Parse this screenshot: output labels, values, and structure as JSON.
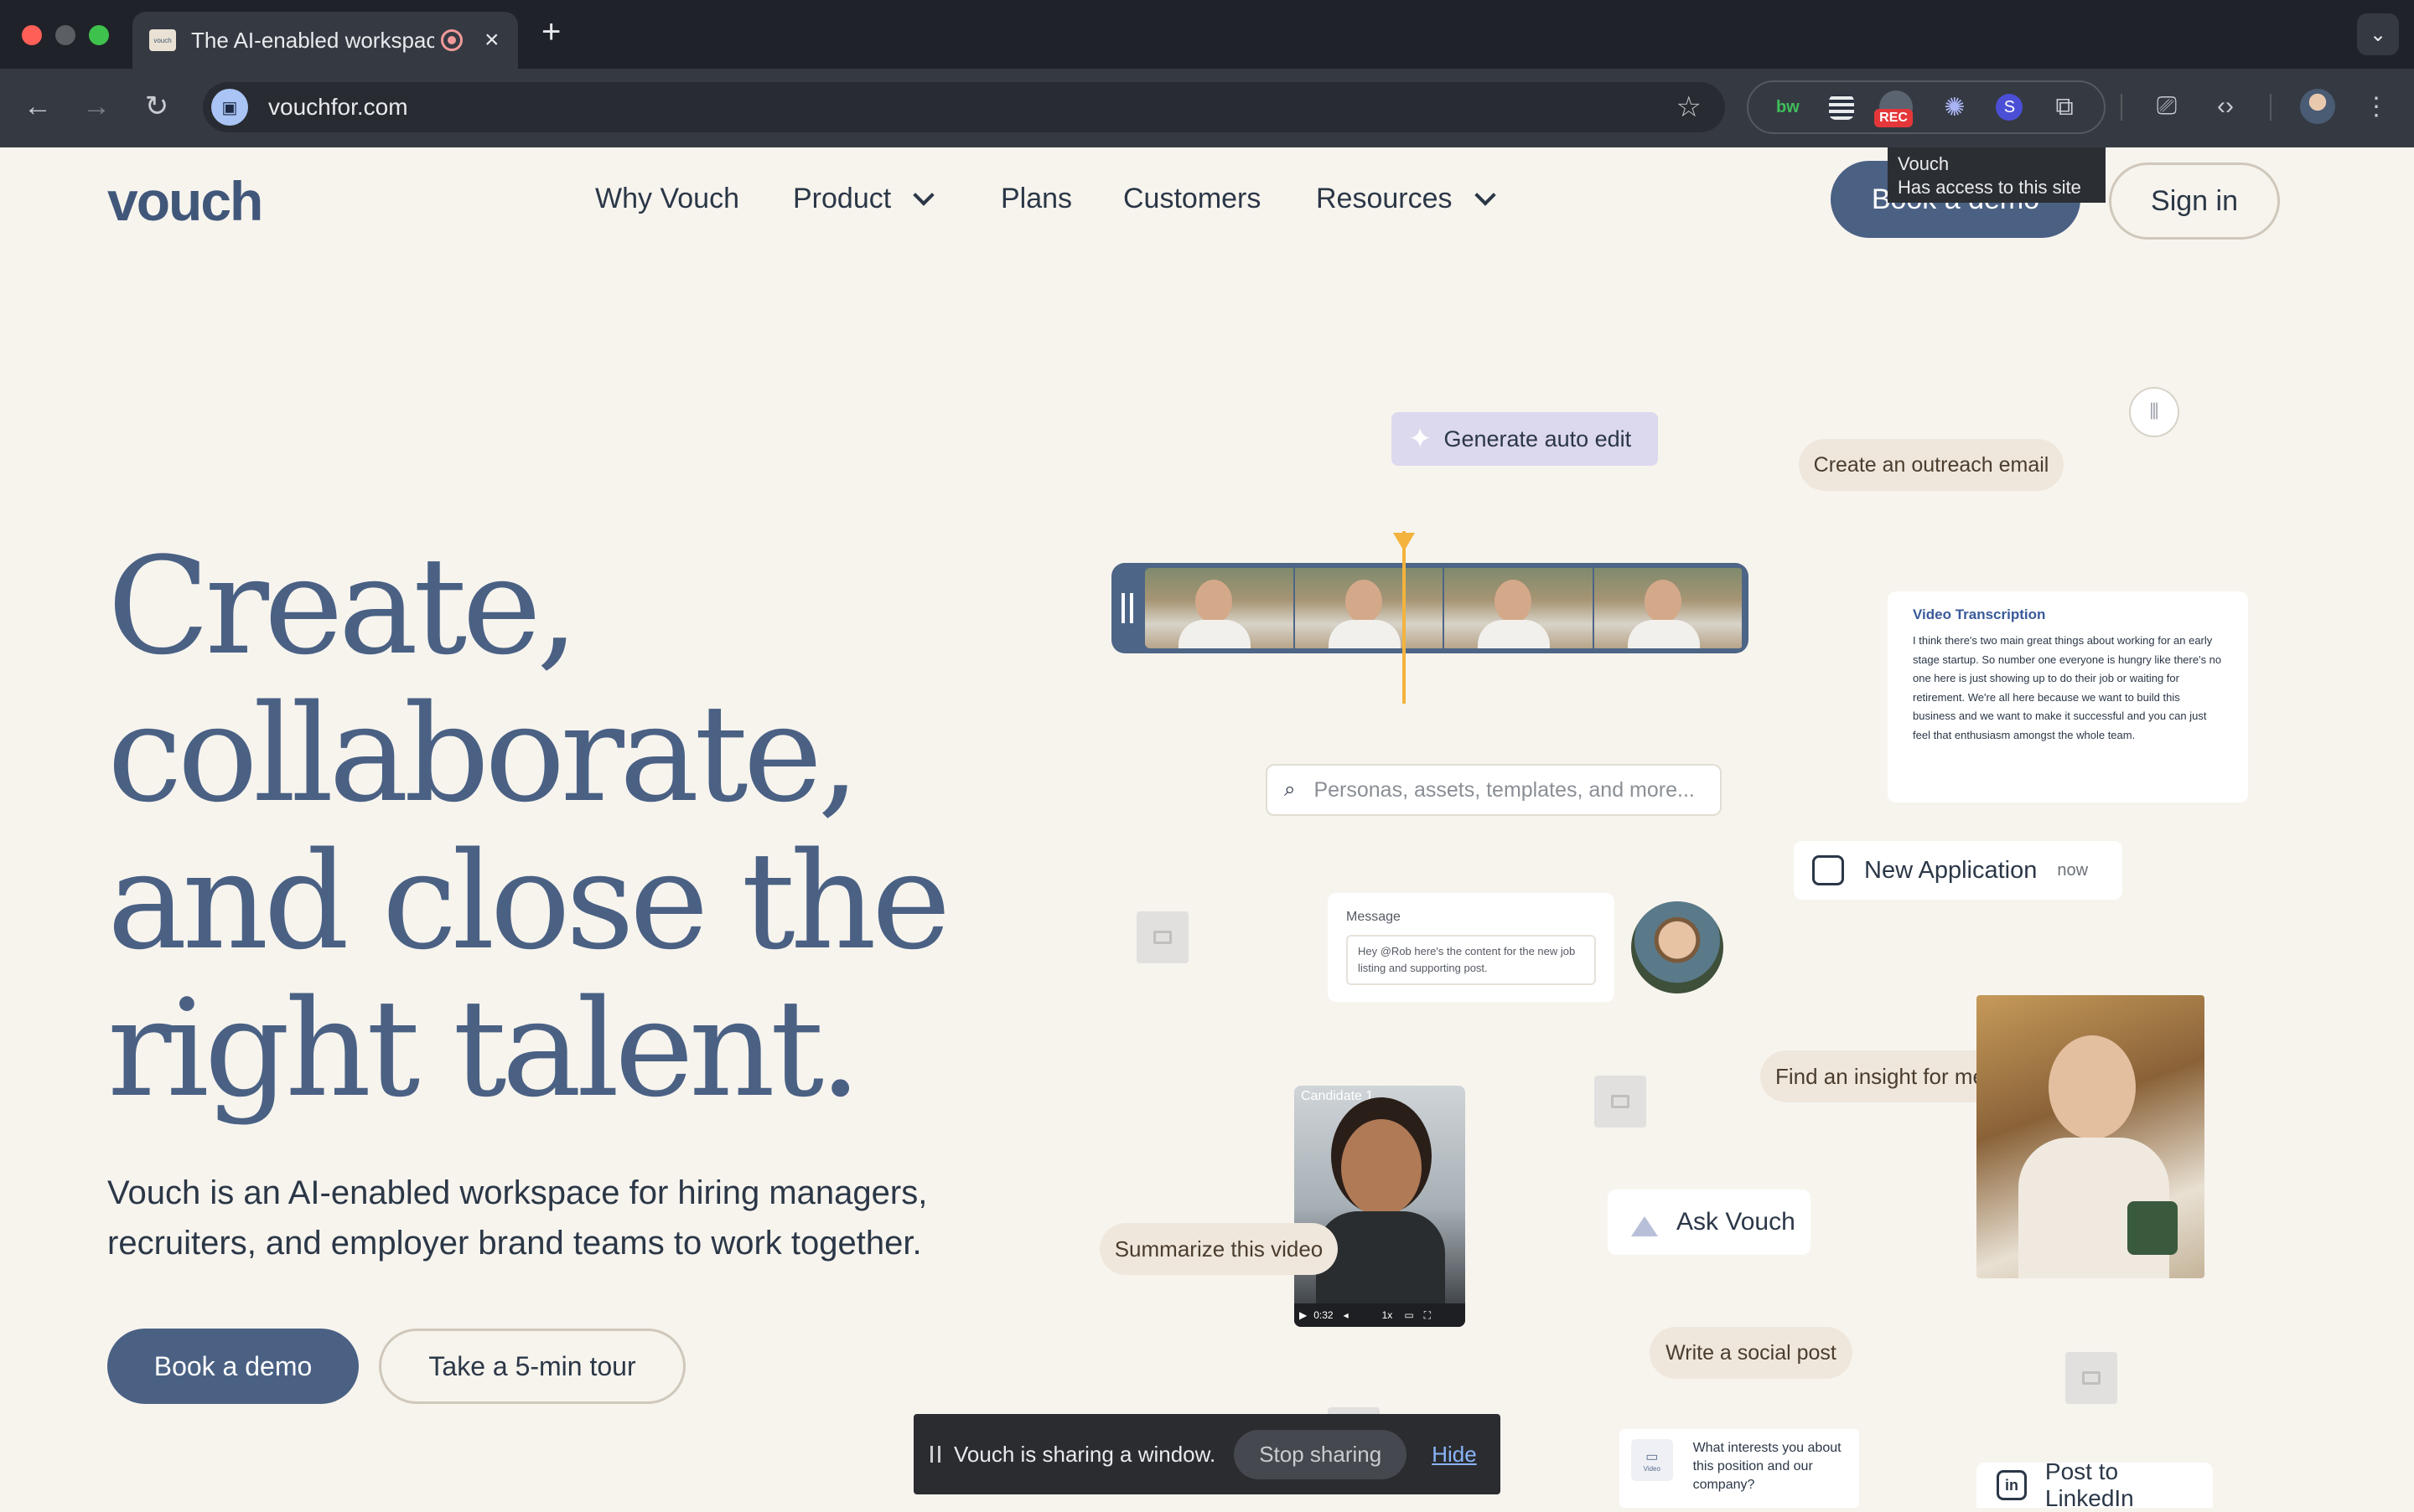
{
  "browser": {
    "tab_title": "The AI-enabled workspace",
    "favicon_text": "vouch",
    "url": "vouchfor.com",
    "ext_rec_badge": "REC",
    "ext_s_label": "S",
    "ext_bw_label": "bw",
    "tooltip": {
      "title": "Vouch",
      "subtitle": "Has access to this site"
    }
  },
  "nav": {
    "logo": "vouch",
    "items": [
      "Why Vouch",
      "Product",
      "Plans",
      "Customers",
      "Resources"
    ],
    "book_demo": "Book a demo",
    "sign_in": "Sign in"
  },
  "hero": {
    "lines": [
      "Create,",
      "collaborate,",
      "and close the",
      "right talent."
    ],
    "subtitle": "Vouch is an AI-enabled workspace for hiring managers, recruiters, and employer brand teams to work together.",
    "cta_demo": "Book a demo",
    "cta_tour": "Take a 5-min tour"
  },
  "collage": {
    "generate_auto_edit": "Generate auto edit",
    "create_outreach_email": "Create an outreach email",
    "transcription_title": "Video Transcription",
    "transcription_text": "I think there's two main great things about working for an early stage startup. So number one everyone is hungry like there's no one here is just showing up to do their job or waiting for retirement. We're all here because we want to build this business and we want to make it successful and you can just feel that enthusiasm amongst the whole team.",
    "search_placeholder": "Personas, assets, templates, and more...",
    "new_application": "New Application",
    "new_application_time": "now",
    "message_label": "Message",
    "message_text": "Hey @Rob here's the content for the new job listing and supporting post.",
    "find_insight": "Find an insight for me",
    "candidate_label": "Candidate 1",
    "candidate_time": "0:32",
    "candidate_speed": "1x",
    "summarize_video": "Summarize this video",
    "ask_vouch": "Ask Vouch",
    "write_social_post": "Write a social post",
    "question_text": "What interests you about this position and our company?",
    "question_icon_label": "Video",
    "post_linkedin": "Post to LinkedIn"
  },
  "share_bar": {
    "text": "Vouch is sharing a window.",
    "stop": "Stop sharing",
    "hide": "Hide"
  },
  "colors": {
    "brand": "#4a6184",
    "background": "#f7f4ee",
    "accent": "#f3b33c"
  }
}
